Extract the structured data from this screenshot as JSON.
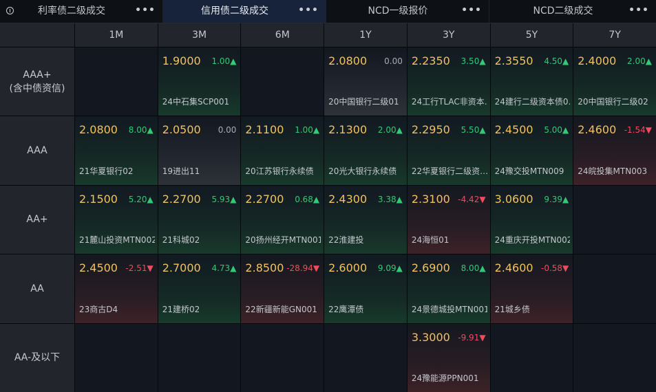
{
  "tabs": [
    {
      "label": "利率债二级成交",
      "more": "•••",
      "active": false
    },
    {
      "label": "信用债二级成交",
      "more": "•••",
      "active": true
    },
    {
      "label": "NCD一级报价",
      "more": "•••",
      "active": false
    },
    {
      "label": "NCD二级成交",
      "more": "•••",
      "active": false
    }
  ],
  "columns": [
    "1M",
    "3M",
    "6M",
    "1Y",
    "3Y",
    "5Y",
    "7Y"
  ],
  "rows": [
    {
      "label": [
        "AAA+",
        "(含中债资信)"
      ],
      "cells": [
        null,
        {
          "rate": "1.9000",
          "change": "1.00▲",
          "trend": "up",
          "name": "24中石集SCP001"
        },
        null,
        {
          "rate": "2.0800",
          "change": "0.00",
          "trend": "flat",
          "name": "20中国银行二级01"
        },
        {
          "rate": "2.2350",
          "change": "3.50▲",
          "trend": "up",
          "name": "24工行TLAC非资本…"
        },
        {
          "rate": "2.3550",
          "change": "4.50▲",
          "trend": "up",
          "name": "24建行二级资本债0…"
        },
        {
          "rate": "2.4000",
          "change": "2.00▲",
          "trend": "up",
          "name": "20中国银行二级02"
        }
      ]
    },
    {
      "label": [
        "AAA"
      ],
      "cells": [
        {
          "rate": "2.0800",
          "change": "8.00▲",
          "trend": "up",
          "name": "21华夏银行02"
        },
        {
          "rate": "2.0500",
          "change": "0.00",
          "trend": "flat",
          "name": "19进出11"
        },
        {
          "rate": "2.1100",
          "change": "1.00▲",
          "trend": "up",
          "name": "20江苏银行永续债"
        },
        {
          "rate": "2.1300",
          "change": "2.00▲",
          "trend": "up",
          "name": "20光大银行永续债"
        },
        {
          "rate": "2.2950",
          "change": "5.50▲",
          "trend": "up",
          "name": "22华夏银行二级资…"
        },
        {
          "rate": "2.4500",
          "change": "5.00▲",
          "trend": "up",
          "name": "24豫交投MTN009"
        },
        {
          "rate": "2.4600",
          "change": "-1.54▼",
          "trend": "down",
          "name": "24皖投集MTN003"
        }
      ]
    },
    {
      "label": [
        "AA+"
      ],
      "cells": [
        {
          "rate": "2.1500",
          "change": "5.20▲",
          "trend": "up",
          "name": "21麓山投资MTN002"
        },
        {
          "rate": "2.2700",
          "change": "5.93▲",
          "trend": "up",
          "name": "21科城02"
        },
        {
          "rate": "2.2700",
          "change": "0.68▲",
          "trend": "up",
          "name": "20扬州经开MTN001"
        },
        {
          "rate": "2.4300",
          "change": "3.38▲",
          "trend": "up",
          "name": "22淮建投"
        },
        {
          "rate": "2.3100",
          "change": "-4.42▼",
          "trend": "down",
          "name": "24海恒01"
        },
        {
          "rate": "3.0600",
          "change": "9.39▲",
          "trend": "up",
          "name": "24重庆开投MTN002"
        },
        null
      ]
    },
    {
      "label": [
        "AA"
      ],
      "cells": [
        {
          "rate": "2.4500",
          "change": "-2.51▼",
          "trend": "down",
          "name": "23商古D4"
        },
        {
          "rate": "2.7000",
          "change": "4.73▲",
          "trend": "up",
          "name": "21建桥02"
        },
        {
          "rate": "2.8500",
          "change": "-28.94▼",
          "trend": "down",
          "name": "22新疆新能GN001"
        },
        {
          "rate": "2.6000",
          "change": "9.09▲",
          "trend": "up",
          "name": "22鹰潭债"
        },
        {
          "rate": "2.6900",
          "change": "8.00▲",
          "trend": "up",
          "name": "24景德城投MTN001"
        },
        {
          "rate": "2.4600",
          "change": "-0.58▼",
          "trend": "down",
          "name": "21城乡债"
        },
        null
      ]
    },
    {
      "label": [
        "AA-及以下"
      ],
      "cells": [
        null,
        null,
        null,
        null,
        {
          "rate": "3.3000",
          "change": "-9.91▼",
          "trend": "down",
          "name": "24豫能源PPN001"
        },
        null,
        null
      ]
    }
  ],
  "colors": {
    "rate": "#f2c262",
    "up": "#34c974",
    "down": "#f04c5c",
    "active_tab": "#17233a"
  },
  "icons": {
    "info": "info-circle-icon",
    "more": "more-dots-icon"
  }
}
